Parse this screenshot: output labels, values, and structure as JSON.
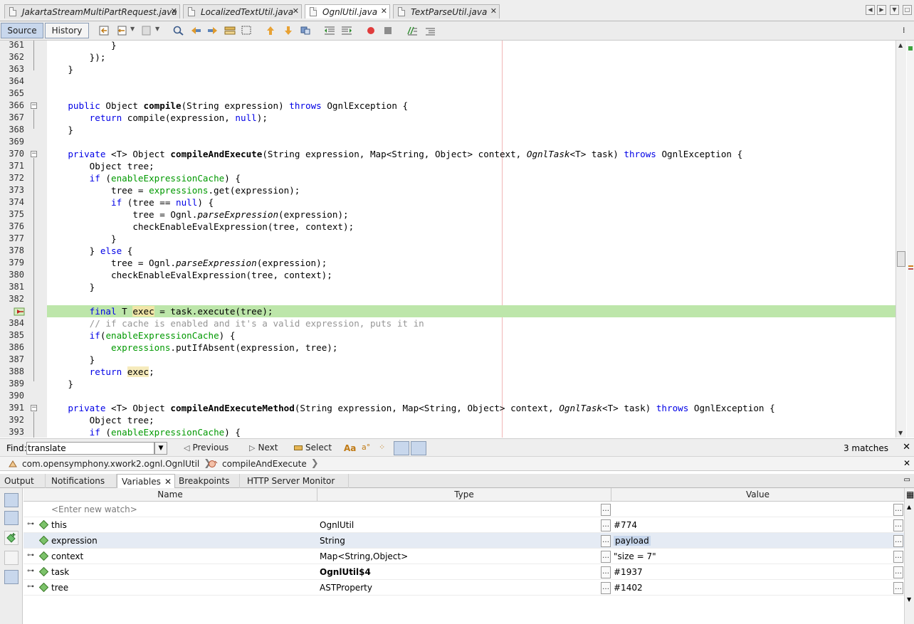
{
  "editor_tabs": [
    {
      "label": "JakartaStreamMultiPartRequest.java",
      "active": false
    },
    {
      "label": "LocalizedTextUtil.java",
      "active": false
    },
    {
      "label": "OgnlUtil.java",
      "active": true
    },
    {
      "label": "TextParseUtil.java",
      "active": false
    }
  ],
  "toolbar": {
    "source_label": "Source",
    "history_label": "History"
  },
  "code": {
    "current_line": 383,
    "lines": [
      {
        "n": "361",
        "html": "            }"
      },
      {
        "n": "362",
        "html": "        });"
      },
      {
        "n": "363",
        "html": "    }"
      },
      {
        "n": "364",
        "html": ""
      },
      {
        "n": "365",
        "html": ""
      },
      {
        "n": "366",
        "html": "    <span class=\"kw\">public</span> Object <span class=\"b\">compile</span>(String expression) <span class=\"kw\">throws</span> OgnlException {"
      },
      {
        "n": "367",
        "html": "        <span class=\"kw\">return</span> compile(expression, <span class=\"kw\">null</span>);"
      },
      {
        "n": "368",
        "html": "    }"
      },
      {
        "n": "369",
        "html": ""
      },
      {
        "n": "370",
        "html": "    <span class=\"kw\">private</span> &lt;T&gt; Object <span class=\"b\">compileAndExecute</span>(String expression, Map&lt;String, Object&gt; context, <span class=\"i\">OgnlTask</span>&lt;T&gt; task) <span class=\"kw\">throws</span> OgnlException {"
      },
      {
        "n": "371",
        "html": "        Object tree;"
      },
      {
        "n": "372",
        "html": "        <span class=\"kw\">if</span> (<span class=\"fld\">enableExpressionCache</span>) {"
      },
      {
        "n": "373",
        "html": "            tree = <span class=\"fld\">expressions</span>.get(expression);"
      },
      {
        "n": "374",
        "html": "            <span class=\"kw\">if</span> (tree == <span class=\"kw\">null</span>) {"
      },
      {
        "n": "375",
        "html": "                tree = Ognl.<span class=\"i\">parseExpression</span>(expression);"
      },
      {
        "n": "376",
        "html": "                checkEnableEvalExpression(tree, context);"
      },
      {
        "n": "377",
        "html": "            }"
      },
      {
        "n": "378",
        "html": "        } <span class=\"kw\">else</span> {"
      },
      {
        "n": "379",
        "html": "            tree = Ognl.<span class=\"i\">parseExpression</span>(expression);"
      },
      {
        "n": "380",
        "html": "            checkEnableEvalExpression(tree, context);"
      },
      {
        "n": "381",
        "html": "        }"
      },
      {
        "n": "382",
        "html": ""
      },
      {
        "n": "",
        "html": "        <span class=\"kw\">final</span> T <span class=\"occ2\">exec</span> = task.execute(tree);"
      },
      {
        "n": "384",
        "html": "        <span class=\"cm\">// if cache is enabled and it's a valid expression, puts it in</span>"
      },
      {
        "n": "385",
        "html": "        <span class=\"kw\">if</span>(<span class=\"fld\">enableExpressionCache</span>) {"
      },
      {
        "n": "386",
        "html": "            <span class=\"fld\">expressions</span>.putIfAbsent(expression, tree);"
      },
      {
        "n": "387",
        "html": "        }"
      },
      {
        "n": "388",
        "html": "        <span class=\"kw\">return</span> <span class=\"occ\">exec</span>;"
      },
      {
        "n": "389",
        "html": "    }"
      },
      {
        "n": "390",
        "html": ""
      },
      {
        "n": "391",
        "html": "    <span class=\"kw\">private</span> &lt;T&gt; Object <span class=\"b\">compileAndExecuteMethod</span>(String expression, Map&lt;String, Object&gt; context, <span class=\"i\">OgnlTask</span>&lt;T&gt; task) <span class=\"kw\">throws</span> OgnlException {"
      },
      {
        "n": "392",
        "html": "        Object tree;"
      },
      {
        "n": "393",
        "html": "        <span class=\"kw\">if</span> (<span class=\"fld\">enableExpressionCache</span>) {"
      }
    ]
  },
  "find": {
    "label": "Find:",
    "value": "translate",
    "previous_label": "Previous",
    "next_label": "Next",
    "select_label": "Select",
    "matches": "3 matches"
  },
  "breadcrumb": {
    "class_path": "com.opensymphony.xwork2.ognl.OgnlUtil",
    "method": "compileAndExecute"
  },
  "panel_tabs": [
    {
      "label": "Output"
    },
    {
      "label": "Notifications"
    },
    {
      "label": "Variables"
    },
    {
      "label": "Breakpoints"
    },
    {
      "label": "HTTP Server Monitor"
    }
  ],
  "variables": {
    "headers": {
      "name": "Name",
      "type": "Type",
      "value": "Value"
    },
    "watch_placeholder": "<Enter new watch>",
    "rows": [
      {
        "name": "this",
        "type": "OgnlUtil",
        "value": "#774",
        "type_bold": false
      },
      {
        "name": "expression",
        "type": "String",
        "value": "payload",
        "type_bold": false
      },
      {
        "name": "context",
        "type": "Map<String,Object>",
        "value": "\"size = 7\"",
        "type_bold": false
      },
      {
        "name": "task",
        "type": "OgnlUtil$4",
        "value": "#1937",
        "type_bold": true
      },
      {
        "name": "tree",
        "type": "ASTProperty",
        "value": "#1402",
        "type_bold": false
      }
    ]
  },
  "colors": {
    "current_line": "#bde6aa",
    "keyword": "#0000e6",
    "field": "#009900",
    "comment": "#969696",
    "selected_toggle": "#c8d7ec"
  }
}
